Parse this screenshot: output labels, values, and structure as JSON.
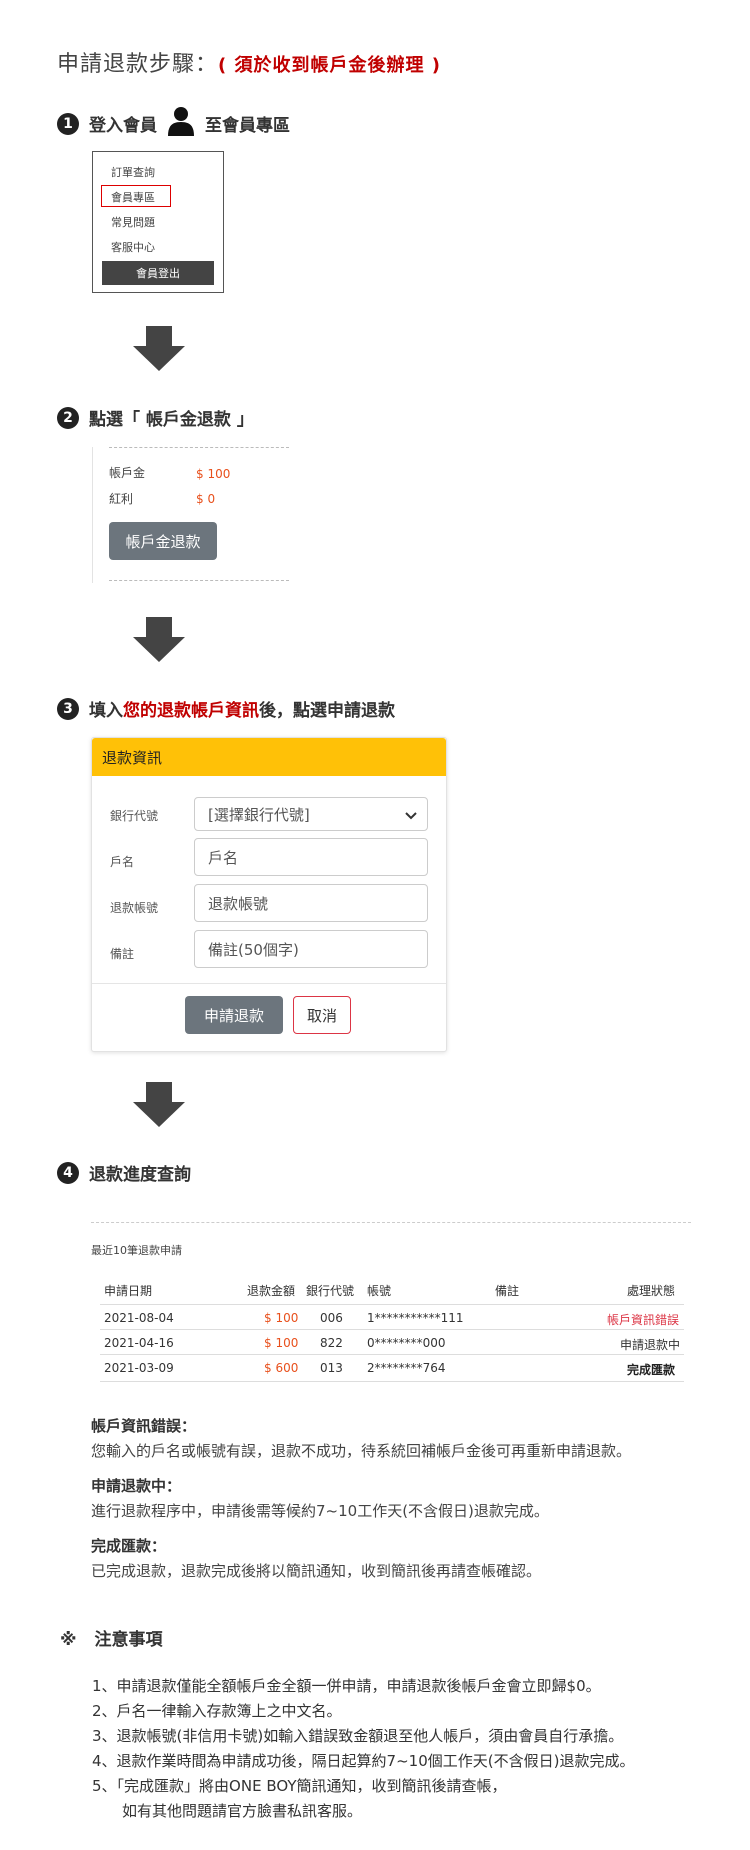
{
  "header": {
    "title": "申請退款步驟：",
    "note": "( 須於收到帳戶金後辦理 )"
  },
  "step1": {
    "number": "1",
    "text_before": "登入會員",
    "text_after": "至會員專區",
    "menu": {
      "items": [
        "訂單查詢",
        "會員專區",
        "常見問題",
        "客服中心"
      ],
      "logout_label": "會員登出"
    }
  },
  "step2": {
    "number": "2",
    "text": "點選「 帳戶金退款 」",
    "balance_label": "帳戶金",
    "balance_value": "$ 100",
    "bonus_label": "紅利",
    "bonus_value": "$ 0",
    "refund_button": "帳戶金退款"
  },
  "step3": {
    "number": "3",
    "text_before": "填入",
    "text_red": "您的退款帳戶資訊",
    "text_after": "後，點選申請退款",
    "form": {
      "title": "退款資訊",
      "bank_label": "銀行代號",
      "bank_value": "[選擇銀行代號]",
      "name_label": "戶名",
      "name_placeholder": "戶名",
      "account_label": "退款帳號",
      "account_placeholder": "退款帳號",
      "memo_label": "備註",
      "memo_placeholder": "備註(50個字)",
      "submit_label": "申請退款",
      "cancel_label": "取消"
    }
  },
  "step4": {
    "number": "4",
    "text": "退款進度查詢",
    "recent_label": "最近10筆退款申請",
    "columns": [
      "申請日期",
      "退款金額",
      "銀行代號",
      "帳號",
      "備註",
      "處理狀態"
    ],
    "rows": [
      {
        "date": "2021-08-04",
        "amount": "$ 100",
        "bank": "006",
        "account": "1***********111",
        "memo": "",
        "status": "帳戶資訊錯誤"
      },
      {
        "date": "2021-04-16",
        "amount": "$ 100",
        "bank": "822",
        "account": "0********000",
        "memo": "",
        "status": "申請退款中"
      },
      {
        "date": "2021-03-09",
        "amount": "$ 600",
        "bank": "013",
        "account": "2********764",
        "memo": "",
        "status": "完成匯款"
      }
    ]
  },
  "explanations": [
    {
      "title": "帳戶資訊錯誤：",
      "body": "您輸入的戶名或帳號有誤，退款不成功，待系統回補帳戶金後可再重新申請退款。"
    },
    {
      "title": "申請退款中：",
      "body": "進行退款程序中，申請後需等候約7~10工作天(不含假日)退款完成。"
    },
    {
      "title": "完成匯款：",
      "body": "已完成退款，退款完成後將以簡訊通知，收到簡訊後再請查帳確認。"
    }
  ],
  "notice": {
    "mark": "※",
    "title": "注意事項",
    "items": [
      "1、申請退款僅能全額帳戶金全額一併申請，申請退款後帳戶金會立即歸$0。",
      "2、戶名一律輸入存款簿上之中文名。",
      "3、退款帳號(非信用卡號)如輸入錯誤致金額退至他人帳戶，須由會員自行承擔。",
      "4、退款作業時間為申請成功後，隔日起算約7~10個工作天(不含假日)退款完成。",
      "5、「完成匯款」將由ONE BOY簡訊通知，收到簡訊後請查帳，",
      "　　如有其他問題請官方臉書私訊客服。"
    ]
  },
  "colors": {
    "accent_red": "#c00000",
    "amount_orange": "#e8501c",
    "form_header": "#ffc107",
    "button_gray": "#6c757d",
    "cancel_border": "#dc3545"
  }
}
